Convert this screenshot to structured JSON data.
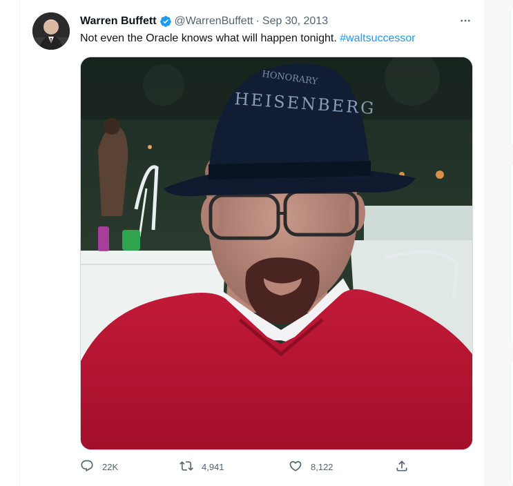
{
  "tweet": {
    "author_name": "Warren Buffett",
    "handle": "@WarrenBuffett",
    "separator": "·",
    "date": "Sep 30, 2013",
    "text_main": "Not even the Oracle knows what will happen tonight. ",
    "hashtag": "#waltsuccessor"
  },
  "media": {
    "hat_text_1": "HONORARY",
    "hat_text_2": "HEISENBERG"
  },
  "actions": {
    "reply_count": "22K",
    "retweet_count": "4,941",
    "like_count": "8,122"
  },
  "colors": {
    "accent": "#1d9bf0",
    "text_secondary": "#536471",
    "sweater": "#b5132f"
  },
  "icons": [
    "verified-badge-icon",
    "more-icon",
    "reply-icon",
    "retweet-icon",
    "like-icon",
    "share-icon"
  ]
}
